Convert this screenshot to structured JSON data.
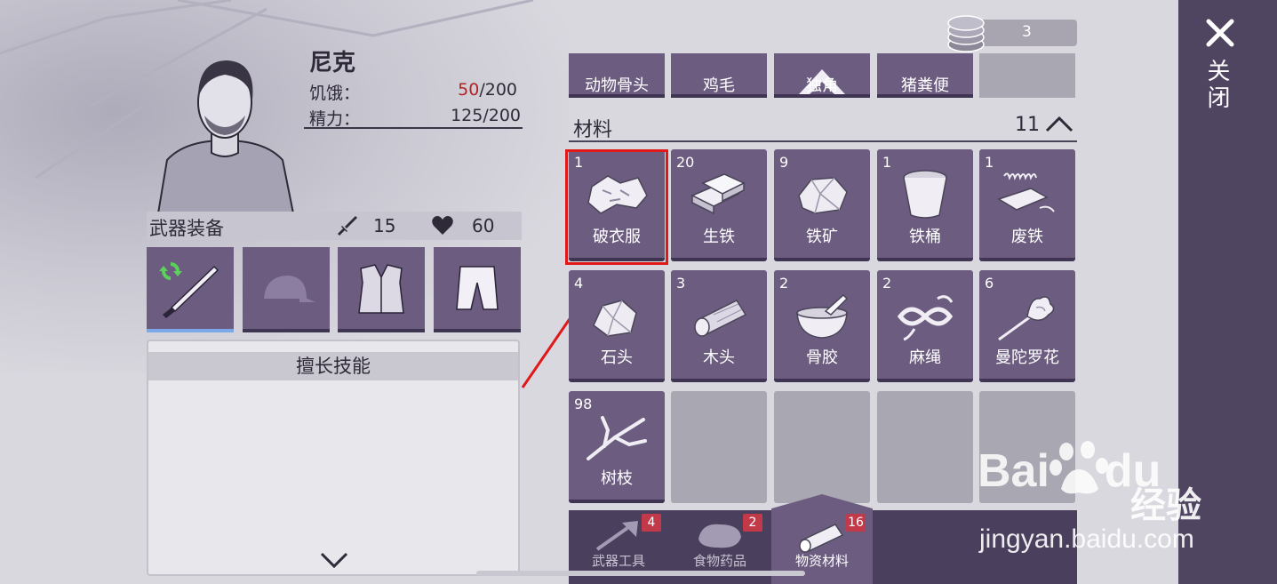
{
  "character": {
    "name": "尼克",
    "hunger_label": "饥饿：",
    "hunger_current": "50",
    "hunger_max": "/200",
    "energy_label": "精力：",
    "energy_value": "125/200"
  },
  "equipment": {
    "title": "武器装备",
    "attack": "15",
    "defense": "60",
    "slots": [
      "knife",
      "cap",
      "vest",
      "shorts"
    ]
  },
  "skills": {
    "title": "擅长技能"
  },
  "currency": {
    "coins": "3"
  },
  "inventory": {
    "top_row": [
      "动物骨头",
      "鸡毛",
      "独角",
      "猪粪便",
      ""
    ],
    "section_title": "材料",
    "section_count": "11",
    "items": [
      {
        "count": "1",
        "name": "破衣服",
        "icon": "rag-icon"
      },
      {
        "count": "20",
        "name": "生铁",
        "icon": "iron-bar-icon"
      },
      {
        "count": "9",
        "name": "铁矿",
        "icon": "iron-ore-icon"
      },
      {
        "count": "1",
        "name": "铁桶",
        "icon": "bucket-icon"
      },
      {
        "count": "1",
        "name": "废铁",
        "icon": "scrap-iron-icon"
      },
      {
        "count": "4",
        "name": "石头",
        "icon": "stone-icon"
      },
      {
        "count": "3",
        "name": "木头",
        "icon": "log-icon"
      },
      {
        "count": "2",
        "name": "骨胶",
        "icon": "bone-glue-icon"
      },
      {
        "count": "2",
        "name": "麻绳",
        "icon": "rope-icon"
      },
      {
        "count": "6",
        "name": "曼陀罗花",
        "icon": "datura-icon"
      },
      {
        "count": "98",
        "name": "树枝",
        "icon": "branch-icon"
      }
    ]
  },
  "tabs": [
    {
      "label": "武器工具",
      "badge": "4"
    },
    {
      "label": "食物药品",
      "badge": "2"
    },
    {
      "label": "物资材料",
      "badge": "16"
    }
  ],
  "close": {
    "label": "关闭"
  },
  "watermark": {
    "brand_a": "Bai",
    "brand_b": "du",
    "brand_cn": "经验",
    "url": "jingyan.baidu.com"
  },
  "colors": {
    "slot_purple": "#6b5c80",
    "empty_slot": "#a9a7b1",
    "close_panel": "#4f4561",
    "highlight_red": "#e01818",
    "hunger_red": "#b02424",
    "badge_red": "#c23a4a"
  }
}
